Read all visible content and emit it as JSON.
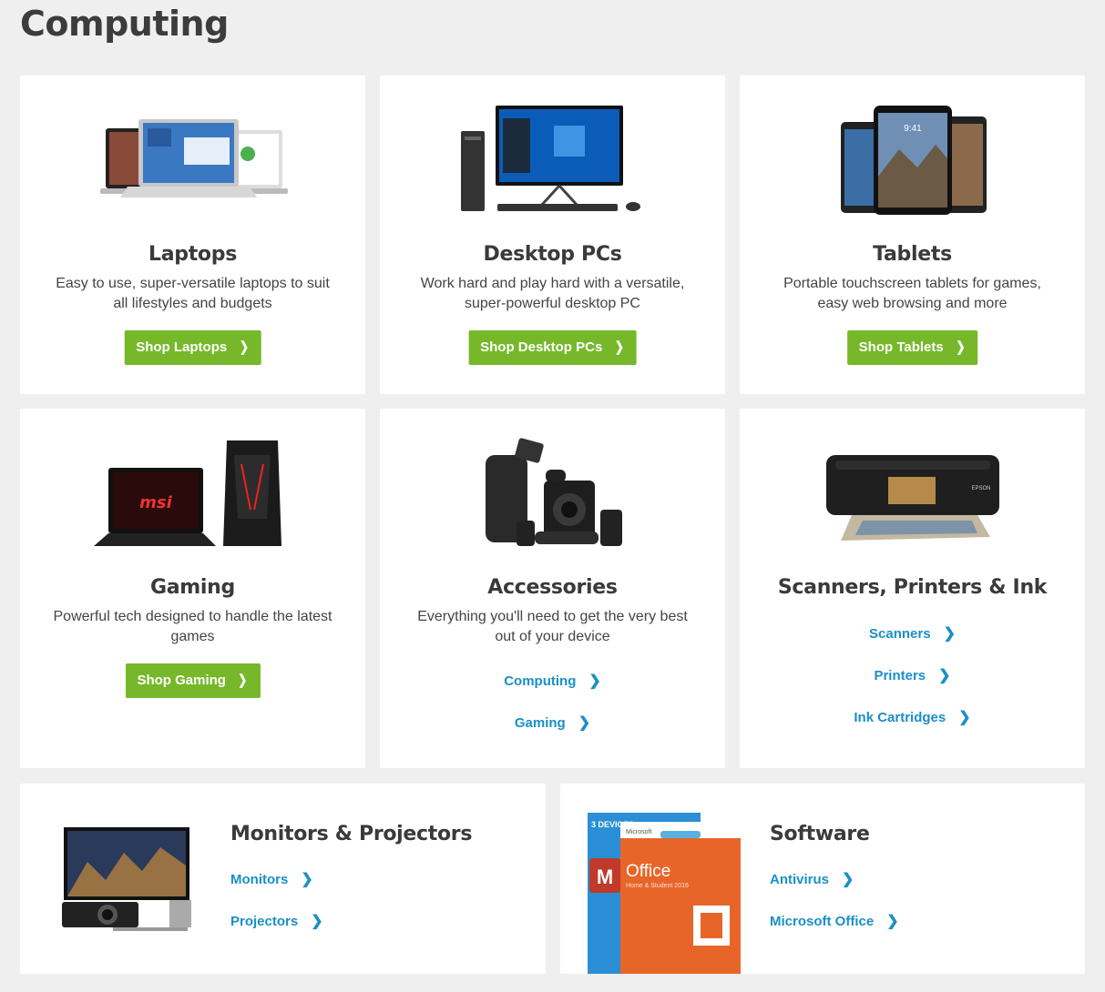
{
  "page": {
    "title": "Computing"
  },
  "cards": {
    "laptops": {
      "title": "Laptops",
      "desc_1": "Easy to use, super-versatile laptops to suit",
      "desc_2": "all lifestyles and budgets",
      "button": "Shop Laptops"
    },
    "desktops": {
      "title": "Desktop PCs",
      "desc_1": "Work hard and play hard with a versatile,",
      "desc_2": "super-powerful desktop PC",
      "button": "Shop Desktop PCs"
    },
    "tablets": {
      "title": "Tablets",
      "desc_1": "Portable touchscreen tablets for games,",
      "desc_2": "easy web browsing and more",
      "button": "Shop Tablets"
    },
    "gaming": {
      "title": "Gaming",
      "desc_1": "Powerful tech designed to handle the latest",
      "desc_2": "games",
      "button": "Shop Gaming"
    },
    "accessories": {
      "title": "Accessories",
      "desc_1": "Everything you'll need to get the very best",
      "desc_2": "out of your device",
      "links": [
        "Computing",
        "Gaming"
      ]
    },
    "printers": {
      "title": "Scanners, Printers & Ink",
      "links": [
        "Scanners",
        "Printers",
        "Ink Cartridges"
      ]
    },
    "monitors": {
      "title": "Monitors & Projectors",
      "links": [
        "Monitors",
        "Projectors"
      ]
    },
    "software": {
      "title": "Software",
      "links": [
        "Antivirus",
        "Microsoft Office"
      ],
      "box_text": {
        "devices": "3 DEVICES",
        "brand": "Microsoft",
        "product": "Office",
        "edition": "Home & Student 2016",
        "antivirus_logo": "M"
      }
    }
  },
  "colors": {
    "button_green": "#76b82a",
    "link_blue": "#1a8fc7",
    "background": "#efefef"
  }
}
